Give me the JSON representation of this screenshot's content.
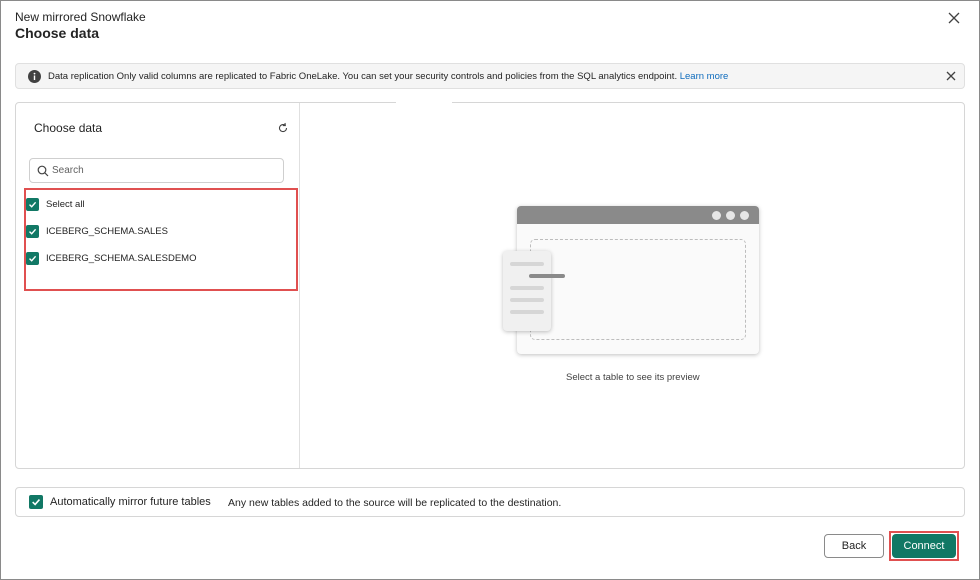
{
  "dialog": {
    "subtitle": "New mirrored Snowflake",
    "title": "Choose data"
  },
  "banner": {
    "text": "Data replication Only valid columns are replicated to Fabric OneLake. You can set your security controls and policies from the SQL analytics endpoint.",
    "link": "Learn more"
  },
  "left_panel": {
    "heading": "Choose data",
    "search_placeholder": "Search",
    "items": [
      {
        "label": "Select all",
        "checked": true
      },
      {
        "label": "ICEBERG_SCHEMA.SALES",
        "checked": true
      },
      {
        "label": "ICEBERG_SCHEMA.SALESDEMO",
        "checked": true
      }
    ]
  },
  "preview": {
    "caption": "Select a table to see its preview"
  },
  "auto_mirror": {
    "label": "Automatically mirror future tables",
    "description": "Any new tables added to the source will be replicated to the destination.",
    "checked": true
  },
  "buttons": {
    "back": "Back",
    "connect": "Connect"
  },
  "colors": {
    "accent": "#117865",
    "highlight": "#e05050",
    "link": "#0f6cbd"
  },
  "icons": {
    "close": "close-icon",
    "info": "info-icon",
    "refresh": "refresh-icon",
    "search": "search-icon",
    "check": "checkmark-icon"
  }
}
